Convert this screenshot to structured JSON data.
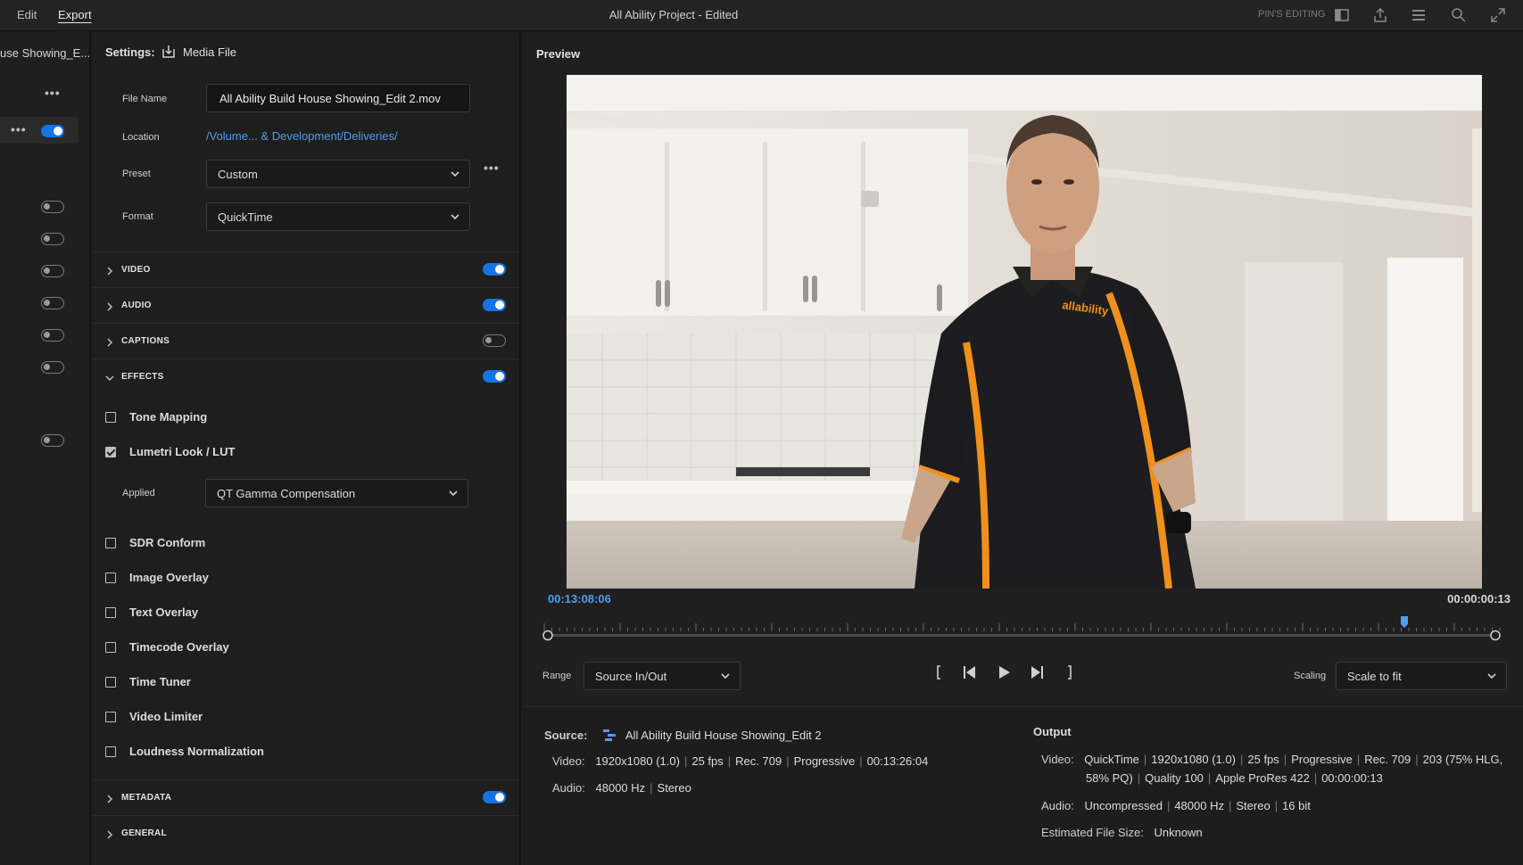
{
  "menu": {
    "edit": "Edit",
    "export": "Export"
  },
  "title": "All Ability Project - Edited",
  "topbar": {
    "pins_editing": "PIN'S EDITING"
  },
  "sidebar": {
    "sequence_name": "use Showing_E..."
  },
  "settings": {
    "label": "Settings:",
    "media_file": "Media File",
    "file_name_label": "File Name",
    "file_name": "All Ability Build House Showing_Edit 2.mov",
    "location_label": "Location",
    "location": "/Volume... & Development/Deliveries/",
    "preset_label": "Preset",
    "preset": "Custom",
    "format_label": "Format",
    "format": "QuickTime",
    "sections": {
      "video": "VIDEO",
      "audio": "AUDIO",
      "captions": "CAPTIONS",
      "effects": "EFFECTS",
      "metadata": "METADATA",
      "general": "GENERAL"
    },
    "effects": {
      "tone_mapping": "Tone Mapping",
      "lumetri": "Lumetri Look / LUT",
      "applied_label": "Applied",
      "applied": "QT Gamma Compensation",
      "sdr_conform": "SDR Conform",
      "image_overlay": "Image Overlay",
      "text_overlay": "Text Overlay",
      "timecode_overlay": "Timecode Overlay",
      "time_tuner": "Time Tuner",
      "video_limiter": "Video Limiter",
      "loudness": "Loudness Normalization"
    }
  },
  "preview": {
    "title": "Preview",
    "timecode_in": "00:13:08:06",
    "duration": "00:00:00:13",
    "range_label": "Range",
    "range": "Source In/Out",
    "scaling_label": "Scaling",
    "scaling": "Scale to fit",
    "logo_text": "allability"
  },
  "source": {
    "label": "Source:",
    "name": "All Ability Build House Showing_Edit 2",
    "video_label": "Video:",
    "video": [
      "1920x1080 (1.0)",
      "25 fps",
      "Rec. 709",
      "Progressive",
      "00:13:26:04"
    ],
    "audio_label": "Audio:",
    "audio": [
      "48000 Hz",
      "Stereo"
    ]
  },
  "output": {
    "label": "Output",
    "video_label": "Video:",
    "video_line1": [
      "QuickTime",
      "1920x1080 (1.0)",
      "25 fps",
      "Progressive",
      "Rec. 709",
      "203 (75% HLG,"
    ],
    "video_line2": [
      "58% PQ)",
      "Quality 100",
      "Apple ProRes 422",
      "00:00:00:13"
    ],
    "audio_label": "Audio:",
    "audio": [
      "Uncompressed",
      "48000 Hz",
      "Stereo",
      "16 bit"
    ],
    "size_label": "Estimated File Size:",
    "size": "Unknown"
  },
  "colors": {
    "accent": "#1473e6",
    "link": "#4d9cf0"
  }
}
